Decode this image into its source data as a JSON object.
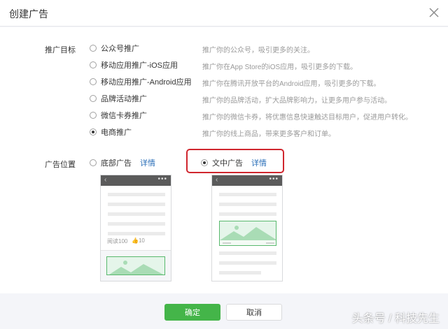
{
  "dialog": {
    "title": "创建广告",
    "close_icon": "close-icon"
  },
  "goal": {
    "label": "推广目标",
    "options": [
      {
        "label": "公众号推广",
        "desc": "推广你的公众号，吸引更多的关注。",
        "checked": false
      },
      {
        "label": "移动应用推广-iOS应用",
        "desc": "推广你在App Store的iOS应用，吸引更多的下载。",
        "checked": false
      },
      {
        "label": "移动应用推广-Android应用",
        "desc": "推广你在腾讯开放平台的Android应用，吸引更多的下载。",
        "checked": false
      },
      {
        "label": "品牌活动推广",
        "desc": "推广你的品牌活动，扩大品牌影响力，让更多用户参与活动。",
        "checked": false
      },
      {
        "label": "微信卡券推广",
        "desc": "推广你的微信卡券，将优惠信息快速触达目标用户，促进用户转化。",
        "checked": false
      },
      {
        "label": "电商推广",
        "desc": "推广你的线上商品，带来更多客户和订单。",
        "checked": true
      }
    ]
  },
  "position": {
    "label": "广告位置",
    "options": [
      {
        "label": "底部广告",
        "link": "详情",
        "checked": false
      },
      {
        "label": "文中广告",
        "link": "详情",
        "checked": true
      }
    ]
  },
  "preview": {
    "back_icon": "‹",
    "more_icon": "•••",
    "read_count": "阅读100",
    "like_count": "10"
  },
  "buttons": {
    "confirm": "确定",
    "cancel": "取消"
  },
  "watermark": "头条号 / 科技先生",
  "colors": {
    "primary": "#44b549",
    "link": "#2b6fb8",
    "highlight": "#d0262e",
    "ad_fill": "#e5f5ea"
  }
}
